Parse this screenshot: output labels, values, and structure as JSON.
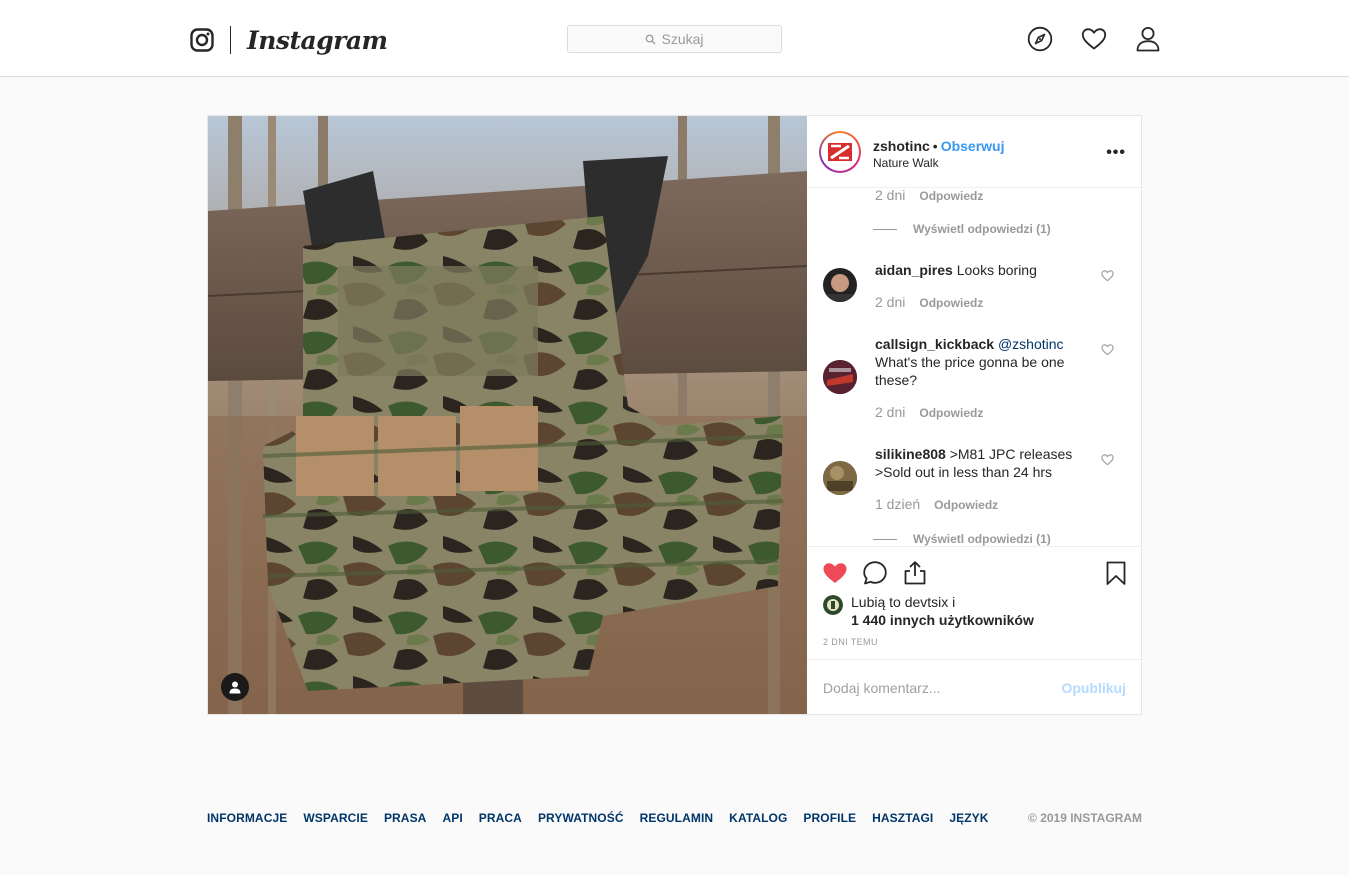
{
  "nav": {
    "wordmark": "Instagram",
    "search_placeholder": "Szukaj",
    "icons": [
      "explore-icon",
      "activity-heart-icon",
      "profile-icon"
    ]
  },
  "post": {
    "username": "zshotinc",
    "dot": "•",
    "follow_label": "Obserwuj",
    "location": "Nature Walk",
    "more_label": "•••",
    "comments": [
      {
        "time": "2 dni",
        "reply_label": "Odpowiedz"
      },
      {
        "view_replies": "Wyświetl odpowiedzi (1)"
      },
      {
        "username": "aidan_pires",
        "text": "Looks boring",
        "time": "2 dni",
        "reply_label": "Odpowiedz"
      },
      {
        "username": "callsign_kickback",
        "mention": "@zshotinc",
        "text": "What's the price gonna be one these?",
        "time": "2 dni",
        "reply_label": "Odpowiedz"
      },
      {
        "username": "silikine808",
        "text": ">M81 JPC releases >Sold out in less than 24 hrs",
        "time": "1 dzień",
        "reply_label": "Odpowiedz"
      },
      {
        "view_replies": "Wyświetl odpowiedzi (1)"
      }
    ],
    "likes_line1": "Lubią to devtsix i",
    "likes_line2": "1 440 innych użytkowników",
    "timestamp": "2 DNI TEMU",
    "comment_placeholder": "Dodaj komentarz...",
    "publish_label": "Opublikuj",
    "colors": {
      "like_red": "#ed4956",
      "link_blue": "#3897f0",
      "publish_disabled": "#b3dbff"
    }
  },
  "footer": {
    "links": [
      "INFORMACJE",
      "WSPARCIE",
      "PRASA",
      "API",
      "PRACA",
      "PRYWATNOŚĆ",
      "REGULAMIN",
      "KATALOG",
      "PROFILE",
      "HASZTAGI",
      "JĘZYK"
    ],
    "copyright": "© 2019 INSTAGRAM"
  }
}
